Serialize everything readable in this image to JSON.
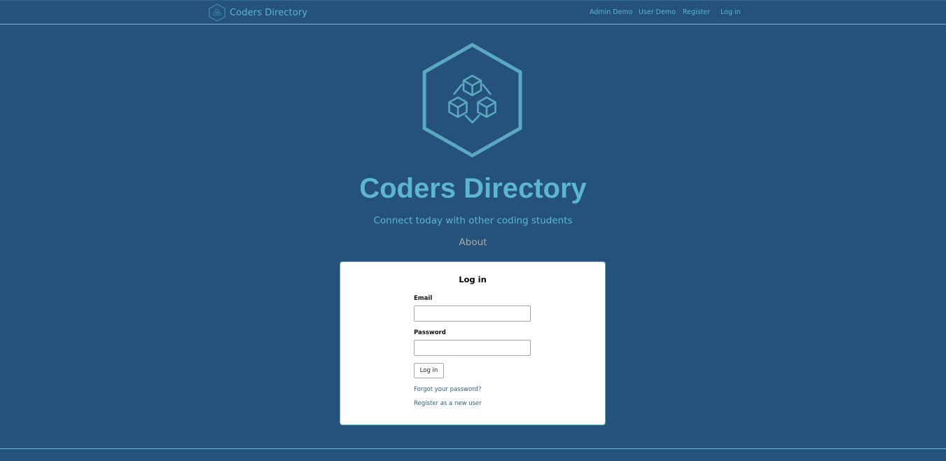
{
  "navbar": {
    "brand_text": "Coders Directory",
    "brand_icon": "cubes-hexagon-logo-icon",
    "links": {
      "admin_demo": "Admin Demo",
      "user_demo": "User Demo",
      "register": "Register",
      "login": "Log in"
    }
  },
  "hero": {
    "logo_icon": "cubes-hexagon-logo-icon",
    "title": "Coders Directory",
    "subtitle": "Connect today with other coding students",
    "about_link": "About"
  },
  "login_card": {
    "title": "Log in",
    "email_label": "Email",
    "email_value": "",
    "password_label": "Password",
    "password_value": "",
    "submit_label": "Log in",
    "forgot_password_link": "Forgot your password?",
    "register_link": "Register as a new user"
  },
  "colors": {
    "background": "#25527a",
    "accent": "#5cb6cf",
    "card": "#ffffff",
    "link": "#2c5f8a",
    "muted": "#a9a9a9"
  }
}
